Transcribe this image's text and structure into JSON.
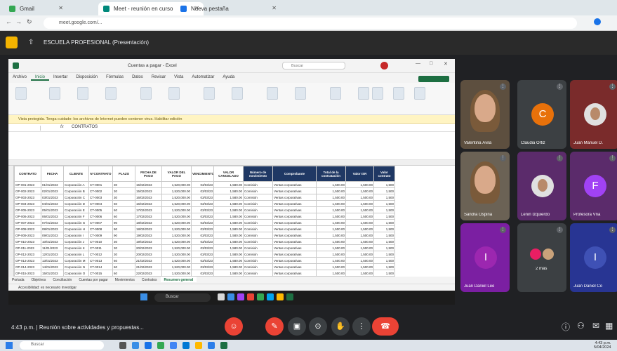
{
  "browser": {
    "tabs": [
      {
        "label": "Gmail",
        "color": "#34a853"
      },
      {
        "label": "Meet - reunión en curso",
        "color": "#00897b"
      },
      {
        "label": "Nueva pestaña",
        "color": "#1a73e8"
      }
    ],
    "url": "meet.google.com/..."
  },
  "meet": {
    "title": "ESCUELA PROFESIONAL (Presentación)",
    "time": "4:43 p.m.",
    "meeting_name": "Reunión sobre actividades y propuestas..."
  },
  "excel": {
    "title": "Cuentas a pagar - Excel",
    "search_placeholder": "Buscar",
    "ribbon_tabs": [
      "Archivo",
      "Inicio",
      "Insertar",
      "Disposición",
      "Fórmulas",
      "Datos",
      "Revisar",
      "Vista",
      "Automatizar",
      "Ayuda"
    ],
    "warning": "Vista protegida. Tenga cuidado: los archivos de Internet pueden contener virus. Habilitar edición",
    "formula_value": "CONTRATOS",
    "headers": [
      "CONTRATO",
      "FECHA",
      "CLIENTE",
      "N°CONTRATO",
      "PLAZO",
      "FECHA DE PAGO",
      "VALOR DEL PAGO",
      "VENCIMIENTO",
      "VALOR CANCELADO",
      "Número de movimiento",
      "Comprobante",
      "Total de la contratación",
      "Valor ISR",
      "Valor contrato"
    ],
    "rows": [
      [
        "OP-001-2023",
        "01/01/2023",
        "Corporación A",
        "CT-0001",
        "30",
        "15/02/2023",
        "1,520,000.00",
        "03/03/23",
        "1,580.00",
        "Comisión",
        "Ventas corporativas",
        "1,500.00",
        "1,500.00",
        "1,500"
      ],
      [
        "OP-002-2023",
        "02/01/2023",
        "Corporación B",
        "CT-0002",
        "30",
        "15/02/2023",
        "1,520,000.00",
        "03/03/23",
        "1,580.00",
        "Comisión",
        "Ventas corporativas",
        "1,500.00",
        "1,500.00",
        "1,500"
      ],
      [
        "OP-003-2023",
        "03/01/2023",
        "Corporación C",
        "CT-0003",
        "30",
        "16/02/2023",
        "1,520,000.00",
        "03/03/23",
        "1,580.00",
        "Comisión",
        "Ventas corporativas",
        "1,500.00",
        "1,500.00",
        "1,500"
      ],
      [
        "OP-004-2023",
        "04/01/2023",
        "Corporación D",
        "CT-0004",
        "60",
        "16/02/2023",
        "1,520,000.00",
        "03/03/23",
        "1,580.00",
        "Comisión",
        "Ventas corporativas",
        "1,500.00",
        "1,500.00",
        "1,500"
      ],
      [
        "OP-005-2023",
        "05/01/2023",
        "Corporación E",
        "CT-0005",
        "60",
        "17/02/2023",
        "1,520,000.00",
        "03/03/23",
        "1,580.00",
        "Comisión",
        "Ventas corporativas",
        "1,500.00",
        "1,500.00",
        "1,500"
      ],
      [
        "OP-006-2023",
        "06/01/2023",
        "Corporación F",
        "CT-0006",
        "60",
        "17/02/2023",
        "1,520,000.00",
        "03/03/23",
        "1,580.00",
        "Comisión",
        "Ventas corporativas",
        "1,500.00",
        "1,500.00",
        "1,500"
      ],
      [
        "OP-007-2023",
        "07/01/2023",
        "Corporación G",
        "CT-0007",
        "90",
        "18/02/2023",
        "1,520,000.00",
        "03/03/23",
        "1,580.00",
        "Comisión",
        "Ventas corporativas",
        "1,500.00",
        "1,500.00",
        "1,500"
      ],
      [
        "OP-008-2023",
        "08/01/2023",
        "Corporación H",
        "CT-0008",
        "90",
        "18/02/2023",
        "1,520,000.00",
        "03/03/23",
        "1,580.00",
        "Comisión",
        "Ventas corporativas",
        "1,500.00",
        "1,500.00",
        "1,500"
      ],
      [
        "OP-009-2023",
        "09/01/2023",
        "Corporación I",
        "CT-0009",
        "90",
        "19/02/2023",
        "1,520,000.00",
        "03/03/23",
        "1,580.00",
        "Comisión",
        "Ventas corporativas",
        "1,500.00",
        "1,500.00",
        "1,500"
      ],
      [
        "OP-010-2023",
        "10/01/2023",
        "Corporación J",
        "CT-0010",
        "30",
        "19/02/2023",
        "1,520,000.00",
        "03/03/23",
        "1,580.00",
        "Comisión",
        "Ventas corporativas",
        "1,500.00",
        "1,500.00",
        "1,500"
      ],
      [
        "OP-011-2023",
        "11/01/2023",
        "Corporación K",
        "CT-0011",
        "30",
        "20/02/2023",
        "1,520,000.00",
        "03/03/23",
        "1,580.00",
        "Comisión",
        "Ventas corporativas",
        "1,500.00",
        "1,500.00",
        "1,500"
      ],
      [
        "OP-012-2023",
        "12/01/2023",
        "Corporación L",
        "CT-0012",
        "30",
        "20/02/2023",
        "1,520,000.00",
        "03/03/23",
        "1,580.00",
        "Comisión",
        "Ventas corporativas",
        "1,500.00",
        "1,500.00",
        "1,500"
      ],
      [
        "OP-013-2023",
        "13/01/2023",
        "Corporación M",
        "CT-0013",
        "60",
        "21/02/2023",
        "1,520,000.00",
        "03/03/23",
        "1,580.00",
        "Comisión",
        "Ventas corporativas",
        "1,500.00",
        "1,500.00",
        "1,500"
      ],
      [
        "OP-014-2023",
        "14/01/2023",
        "Corporación N",
        "CT-0014",
        "60",
        "21/02/2023",
        "1,520,000.00",
        "03/03/23",
        "1,580.00",
        "Comisión",
        "Ventas corporativas",
        "1,500.00",
        "1,500.00",
        "1,500"
      ],
      [
        "OP-015-2023",
        "15/01/2023",
        "Corporación O",
        "CT-0015",
        "60",
        "22/02/2023",
        "1,520,000.00",
        "03/03/23",
        "1,580.00",
        "Comisión",
        "Ventas corporativas",
        "1,500.00",
        "1,500.00",
        "1,500"
      ]
    ],
    "sheet_tabs": [
      "Portada",
      "Objetivos",
      "Conciliación",
      "Cuentas por pagar",
      "Movimientos",
      "Contratos",
      "Resumen general"
    ],
    "status": "Accesibilidad: es necesario investigar",
    "taskbar_search": "Buscar"
  },
  "participants": [
    {
      "name": "Valentina Ávila",
      "type": "video",
      "bg": "#5d4f3f"
    },
    {
      "name": "Claudia Ortiz",
      "type": "letter",
      "letter": "C",
      "bg": "#3c4043",
      "circle": "#e8710a"
    },
    {
      "name": "Juan Manuel D.",
      "type": "photo",
      "bg": "#7a2b2b"
    },
    {
      "name": "Sandra Ospina",
      "type": "video",
      "bg": "#6b6255"
    },
    {
      "name": "Lenin Izquierdo",
      "type": "photo",
      "bg": "#5b2b6b"
    },
    {
      "name": "Profesora Vna",
      "type": "letter",
      "letter": "F",
      "bg": "#5b2b6b",
      "circle": "#a142f4"
    },
    {
      "name": "Juan Daniel Lee",
      "type": "letter",
      "letter": "I",
      "bg": "#7b1fa2",
      "circle": "#9c27b0"
    },
    {
      "name": "2 más",
      "type": "group",
      "bg": "#3c4043"
    },
    {
      "name": "Juan Daniel Co",
      "type": "letter",
      "letter": "I",
      "bg": "#283593",
      "circle": "#3f51b5"
    }
  ],
  "controls": [
    {
      "name": "reactions",
      "glyph": "☺",
      "color": "#ea4335"
    },
    {
      "name": "captions",
      "glyph": "✎",
      "color": "#ea4335"
    },
    {
      "name": "present",
      "glyph": "▣",
      "color": "#3c4043"
    },
    {
      "name": "more",
      "glyph": "⊙",
      "color": "#3c4043"
    },
    {
      "name": "hand",
      "glyph": "✋",
      "color": "#3c4043"
    },
    {
      "name": "options",
      "glyph": "⋮",
      "color": "#3c4043"
    },
    {
      "name": "leave",
      "glyph": "☎",
      "color": "#ea4335"
    }
  ],
  "os": {
    "search": "Buscar",
    "time": "4:43 p.m.",
    "date": "5/04/2024"
  }
}
